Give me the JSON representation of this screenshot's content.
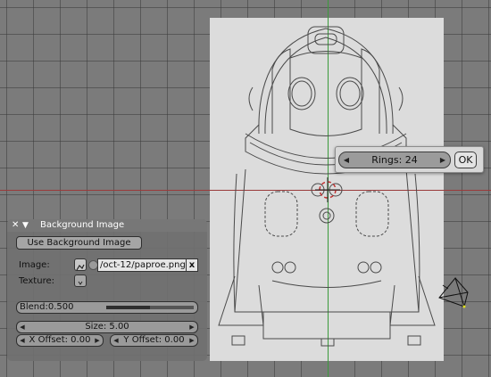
{
  "popup": {
    "rings_label": "Rings: 24",
    "ok_label": "OK"
  },
  "panel": {
    "title": "Background Image",
    "use_bg_button": "Use Background Image",
    "image_label": "Image:",
    "image_path": "/oct-12/paproe.png",
    "clear_icon_text": "x",
    "texture_label": "Texture:",
    "blend_label": "Blend:0.500",
    "blend_value": 0.5,
    "size_label": "Size: 5.00",
    "x_offset_label": "X Offset: 0.00",
    "y_offset_label": "Y Offset: 0.00"
  },
  "icons": {
    "close": "close-icon",
    "collapse": "triangle-down-icon",
    "image_browse": "image-browse-icon",
    "texture_browse": "texture-browse-icon",
    "camera": "camera-icon"
  },
  "colors": {
    "viewport_bg": "#7b7b7b",
    "bg_image": "#dcdcdc",
    "x_axis": "#9a3a3a",
    "y_axis": "#3b9a3b"
  }
}
